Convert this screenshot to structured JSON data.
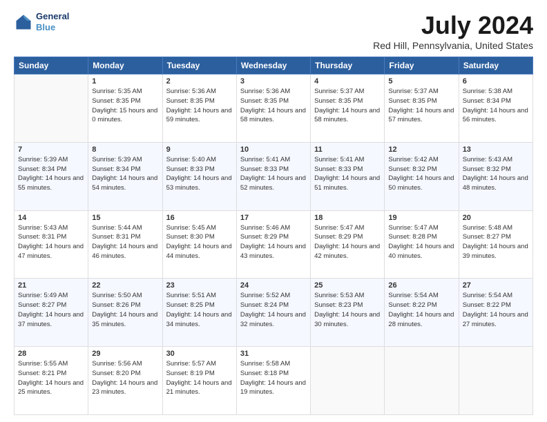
{
  "logo": {
    "line1": "General",
    "line2": "Blue"
  },
  "title": "July 2024",
  "subtitle": "Red Hill, Pennsylvania, United States",
  "headers": [
    "Sunday",
    "Monday",
    "Tuesday",
    "Wednesday",
    "Thursday",
    "Friday",
    "Saturday"
  ],
  "weeks": [
    [
      {
        "day": "",
        "sunrise": "",
        "sunset": "",
        "daylight": ""
      },
      {
        "day": "1",
        "sunrise": "Sunrise: 5:35 AM",
        "sunset": "Sunset: 8:35 PM",
        "daylight": "Daylight: 15 hours and 0 minutes."
      },
      {
        "day": "2",
        "sunrise": "Sunrise: 5:36 AM",
        "sunset": "Sunset: 8:35 PM",
        "daylight": "Daylight: 14 hours and 59 minutes."
      },
      {
        "day": "3",
        "sunrise": "Sunrise: 5:36 AM",
        "sunset": "Sunset: 8:35 PM",
        "daylight": "Daylight: 14 hours and 58 minutes."
      },
      {
        "day": "4",
        "sunrise": "Sunrise: 5:37 AM",
        "sunset": "Sunset: 8:35 PM",
        "daylight": "Daylight: 14 hours and 58 minutes."
      },
      {
        "day": "5",
        "sunrise": "Sunrise: 5:37 AM",
        "sunset": "Sunset: 8:35 PM",
        "daylight": "Daylight: 14 hours and 57 minutes."
      },
      {
        "day": "6",
        "sunrise": "Sunrise: 5:38 AM",
        "sunset": "Sunset: 8:34 PM",
        "daylight": "Daylight: 14 hours and 56 minutes."
      }
    ],
    [
      {
        "day": "7",
        "sunrise": "Sunrise: 5:39 AM",
        "sunset": "Sunset: 8:34 PM",
        "daylight": "Daylight: 14 hours and 55 minutes."
      },
      {
        "day": "8",
        "sunrise": "Sunrise: 5:39 AM",
        "sunset": "Sunset: 8:34 PM",
        "daylight": "Daylight: 14 hours and 54 minutes."
      },
      {
        "day": "9",
        "sunrise": "Sunrise: 5:40 AM",
        "sunset": "Sunset: 8:33 PM",
        "daylight": "Daylight: 14 hours and 53 minutes."
      },
      {
        "day": "10",
        "sunrise": "Sunrise: 5:41 AM",
        "sunset": "Sunset: 8:33 PM",
        "daylight": "Daylight: 14 hours and 52 minutes."
      },
      {
        "day": "11",
        "sunrise": "Sunrise: 5:41 AM",
        "sunset": "Sunset: 8:33 PM",
        "daylight": "Daylight: 14 hours and 51 minutes."
      },
      {
        "day": "12",
        "sunrise": "Sunrise: 5:42 AM",
        "sunset": "Sunset: 8:32 PM",
        "daylight": "Daylight: 14 hours and 50 minutes."
      },
      {
        "day": "13",
        "sunrise": "Sunrise: 5:43 AM",
        "sunset": "Sunset: 8:32 PM",
        "daylight": "Daylight: 14 hours and 48 minutes."
      }
    ],
    [
      {
        "day": "14",
        "sunrise": "Sunrise: 5:43 AM",
        "sunset": "Sunset: 8:31 PM",
        "daylight": "Daylight: 14 hours and 47 minutes."
      },
      {
        "day": "15",
        "sunrise": "Sunrise: 5:44 AM",
        "sunset": "Sunset: 8:31 PM",
        "daylight": "Daylight: 14 hours and 46 minutes."
      },
      {
        "day": "16",
        "sunrise": "Sunrise: 5:45 AM",
        "sunset": "Sunset: 8:30 PM",
        "daylight": "Daylight: 14 hours and 44 minutes."
      },
      {
        "day": "17",
        "sunrise": "Sunrise: 5:46 AM",
        "sunset": "Sunset: 8:29 PM",
        "daylight": "Daylight: 14 hours and 43 minutes."
      },
      {
        "day": "18",
        "sunrise": "Sunrise: 5:47 AM",
        "sunset": "Sunset: 8:29 PM",
        "daylight": "Daylight: 14 hours and 42 minutes."
      },
      {
        "day": "19",
        "sunrise": "Sunrise: 5:47 AM",
        "sunset": "Sunset: 8:28 PM",
        "daylight": "Daylight: 14 hours and 40 minutes."
      },
      {
        "day": "20",
        "sunrise": "Sunrise: 5:48 AM",
        "sunset": "Sunset: 8:27 PM",
        "daylight": "Daylight: 14 hours and 39 minutes."
      }
    ],
    [
      {
        "day": "21",
        "sunrise": "Sunrise: 5:49 AM",
        "sunset": "Sunset: 8:27 PM",
        "daylight": "Daylight: 14 hours and 37 minutes."
      },
      {
        "day": "22",
        "sunrise": "Sunrise: 5:50 AM",
        "sunset": "Sunset: 8:26 PM",
        "daylight": "Daylight: 14 hours and 35 minutes."
      },
      {
        "day": "23",
        "sunrise": "Sunrise: 5:51 AM",
        "sunset": "Sunset: 8:25 PM",
        "daylight": "Daylight: 14 hours and 34 minutes."
      },
      {
        "day": "24",
        "sunrise": "Sunrise: 5:52 AM",
        "sunset": "Sunset: 8:24 PM",
        "daylight": "Daylight: 14 hours and 32 minutes."
      },
      {
        "day": "25",
        "sunrise": "Sunrise: 5:53 AM",
        "sunset": "Sunset: 8:23 PM",
        "daylight": "Daylight: 14 hours and 30 minutes."
      },
      {
        "day": "26",
        "sunrise": "Sunrise: 5:54 AM",
        "sunset": "Sunset: 8:22 PM",
        "daylight": "Daylight: 14 hours and 28 minutes."
      },
      {
        "day": "27",
        "sunrise": "Sunrise: 5:54 AM",
        "sunset": "Sunset: 8:22 PM",
        "daylight": "Daylight: 14 hours and 27 minutes."
      }
    ],
    [
      {
        "day": "28",
        "sunrise": "Sunrise: 5:55 AM",
        "sunset": "Sunset: 8:21 PM",
        "daylight": "Daylight: 14 hours and 25 minutes."
      },
      {
        "day": "29",
        "sunrise": "Sunrise: 5:56 AM",
        "sunset": "Sunset: 8:20 PM",
        "daylight": "Daylight: 14 hours and 23 minutes."
      },
      {
        "day": "30",
        "sunrise": "Sunrise: 5:57 AM",
        "sunset": "Sunset: 8:19 PM",
        "daylight": "Daylight: 14 hours and 21 minutes."
      },
      {
        "day": "31",
        "sunrise": "Sunrise: 5:58 AM",
        "sunset": "Sunset: 8:18 PM",
        "daylight": "Daylight: 14 hours and 19 minutes."
      },
      {
        "day": "",
        "sunrise": "",
        "sunset": "",
        "daylight": ""
      },
      {
        "day": "",
        "sunrise": "",
        "sunset": "",
        "daylight": ""
      },
      {
        "day": "",
        "sunrise": "",
        "sunset": "",
        "daylight": ""
      }
    ]
  ]
}
